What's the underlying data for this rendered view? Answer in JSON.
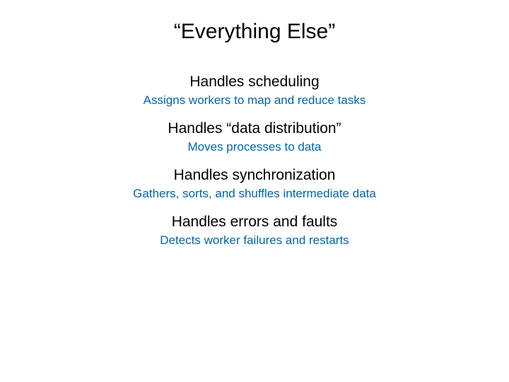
{
  "title": "“Everything Else”",
  "sections": [
    {
      "heading": "Handles scheduling",
      "detail": "Assigns workers to map and reduce tasks"
    },
    {
      "heading": "Handles “data distribution”",
      "detail": "Moves processes to data"
    },
    {
      "heading": "Handles synchronization",
      "detail": "Gathers, sorts, and shuffles intermediate data"
    },
    {
      "heading": "Handles errors and faults",
      "detail": "Detects worker failures and restarts"
    }
  ]
}
